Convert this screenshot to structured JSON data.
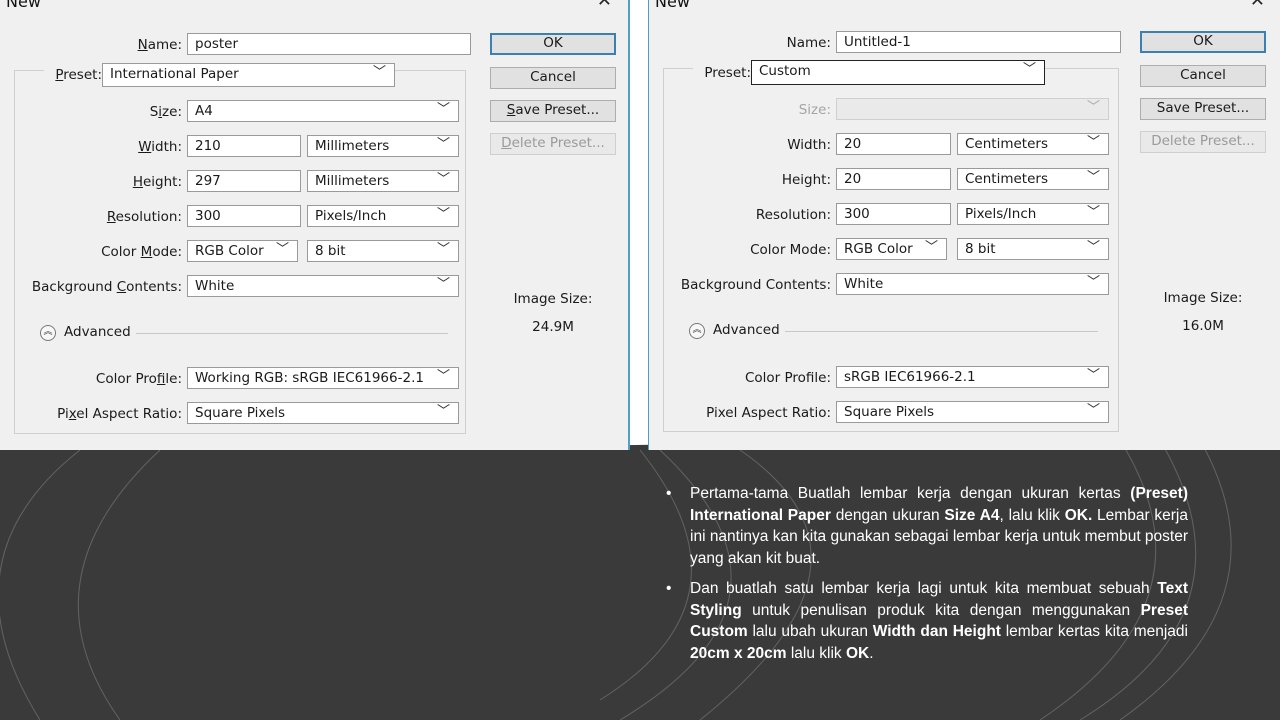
{
  "dialog1": {
    "title": "New",
    "name_label": "Name:",
    "name_value": "poster",
    "preset_label": "Preset:",
    "preset_value": "International Paper",
    "size_label": "Size:",
    "size_value": "A4",
    "width_label": "Width:",
    "width_value": "210",
    "width_unit": "Millimeters",
    "height_label": "Height:",
    "height_value": "297",
    "height_unit": "Millimeters",
    "resolution_label": "Resolution:",
    "resolution_value": "300",
    "resolution_unit": "Pixels/Inch",
    "color_mode_label": "Color Mode:",
    "color_mode_value": "RGB Color",
    "bit_value": "8 bit",
    "background_label": "Background Contents:",
    "background_value": "White",
    "advanced_label": "Advanced",
    "color_profile_label": "Color Profile:",
    "color_profile_value": "Working RGB:  sRGB IEC61966-2.1",
    "pixel_aspect_label": "Pixel Aspect Ratio:",
    "pixel_aspect_value": "Square Pixels",
    "ok_label": "OK",
    "cancel_label": "Cancel",
    "save_preset_label": "Save Preset...",
    "delete_preset_label": "Delete Preset...",
    "image_size_label": "Image Size:",
    "image_size_value": "24.9M"
  },
  "dialog2": {
    "title": "New",
    "name_label": "Name:",
    "name_value": "Untitled-1",
    "preset_label": "Preset:",
    "preset_value": "Custom",
    "size_label": "Size:",
    "size_value": "",
    "width_label": "Width:",
    "width_value": "20",
    "width_unit": "Centimeters",
    "height_label": "Height:",
    "height_value": "20",
    "height_unit": "Centimeters",
    "resolution_label": "Resolution:",
    "resolution_value": "300",
    "resolution_unit": "Pixels/Inch",
    "color_mode_label": "Color Mode:",
    "color_mode_value": "RGB Color",
    "bit_value": "8 bit",
    "background_label": "Background Contents:",
    "background_value": "White",
    "advanced_label": "Advanced",
    "color_profile_label": "Color Profile:",
    "color_profile_value": "sRGB IEC61966-2.1",
    "pixel_aspect_label": "Pixel Aspect Ratio:",
    "pixel_aspect_value": "Square Pixels",
    "ok_label": "OK",
    "cancel_label": "Cancel",
    "save_preset_label": "Save Preset...",
    "delete_preset_label": "Delete Preset...",
    "image_size_label": "Image Size:",
    "image_size_value": "16.0M"
  },
  "notes": {
    "bullet": "•",
    "p1": {
      "t1": "Pertama-tama Buatlah lembar kerja dengan ukuran kertas ",
      "b1": "(Preset) International Paper",
      "t2": " dengan ukuran ",
      "b2": "Size A4",
      "t3": ", lalu klik ",
      "b3": "OK.",
      "t4": " Lembar kerja ini nantinya kan kita gunakan sebagai lembar kerja untuk membut poster yang akan kit buat."
    },
    "p2": {
      "t1": "Dan buatlah satu lembar kerja lagi untuk kita membuat sebuah ",
      "b1": "Text Styling",
      "t2": " untuk penulisan produk kita dengan menggunakan ",
      "b2": "Preset Custom",
      "t3": " lalu ubah ukuran ",
      "b3": "Width dan Height",
      "t4": " lembar kertas kita menjadi ",
      "b4": "20cm x 20cm",
      "t5": " lalu klik ",
      "b5": "OK",
      "t6": "."
    }
  },
  "colors": {
    "slide_dark": "#3a3a3a",
    "slide_light": "#ffffff",
    "dialog_bg": "#f0f0f0",
    "dialog_border": "#4da0c8",
    "ok_border": "#3c7fb1"
  },
  "icons": {
    "close": "close-icon",
    "dropdown": "chevron-down-icon",
    "advanced": "collapse-up-icon"
  }
}
